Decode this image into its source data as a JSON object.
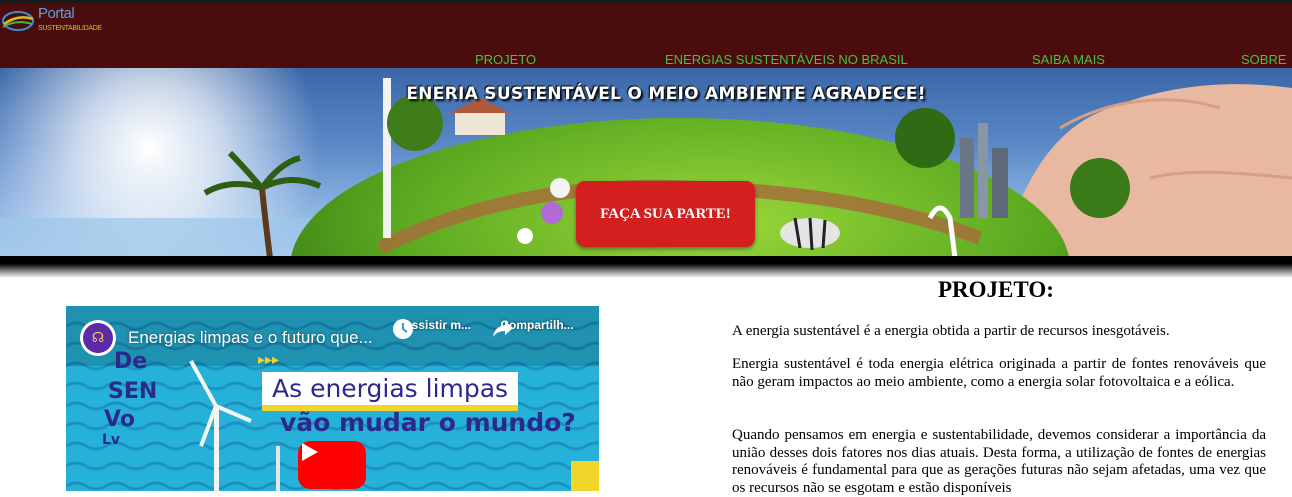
{
  "logo": {
    "title": "Portal",
    "subtitle": "SUSTENTABILIDADE"
  },
  "nav": [
    {
      "label": "PROJETO"
    },
    {
      "label": "ENERGIAS SUSTENTÁVEIS NO BRASIL"
    },
    {
      "label": "SAIBA MAIS"
    },
    {
      "label": "SOBRE"
    }
  ],
  "hero": {
    "title": "ENERIA SUSTENTÁVEL O MEIO AMBIENTE AGRADECE!",
    "cta_label": "FAÇA SUA PARTE!"
  },
  "video": {
    "title": "Energias limpas e o futuro que...",
    "watch_label": "Assistir m...",
    "share_label": "Compartilh...",
    "headline_line1": "As energias limpas",
    "headline_line2": "vão mudar o mundo?"
  },
  "section": {
    "title": "PROJETO:",
    "paragraphs": [
      "A energia sustentável é a energia obtida a partir de recursos inesgotáveis.",
      "Energia sustentável é toda energia elétrica originada a partir de fontes renováveis que não geram impactos ao meio ambiente, como a energia solar fotovoltaica e a eólica.",
      "Quando pensamos em energia e sustentabilidade, devemos considerar a importância da união desses dois fatores nos dias atuais. Desta forma, a utilização de fontes de energias renováveis é fundamental para que as gerações futuras não sejam afetadas, uma vez que os recursos não se esgotam e estão disponíveis"
    ]
  },
  "colors": {
    "header_bg": "#4a0c0c",
    "nav_text": "#44c244",
    "cta_bg": "#d41f1f",
    "youtube_red": "#ff0000"
  }
}
